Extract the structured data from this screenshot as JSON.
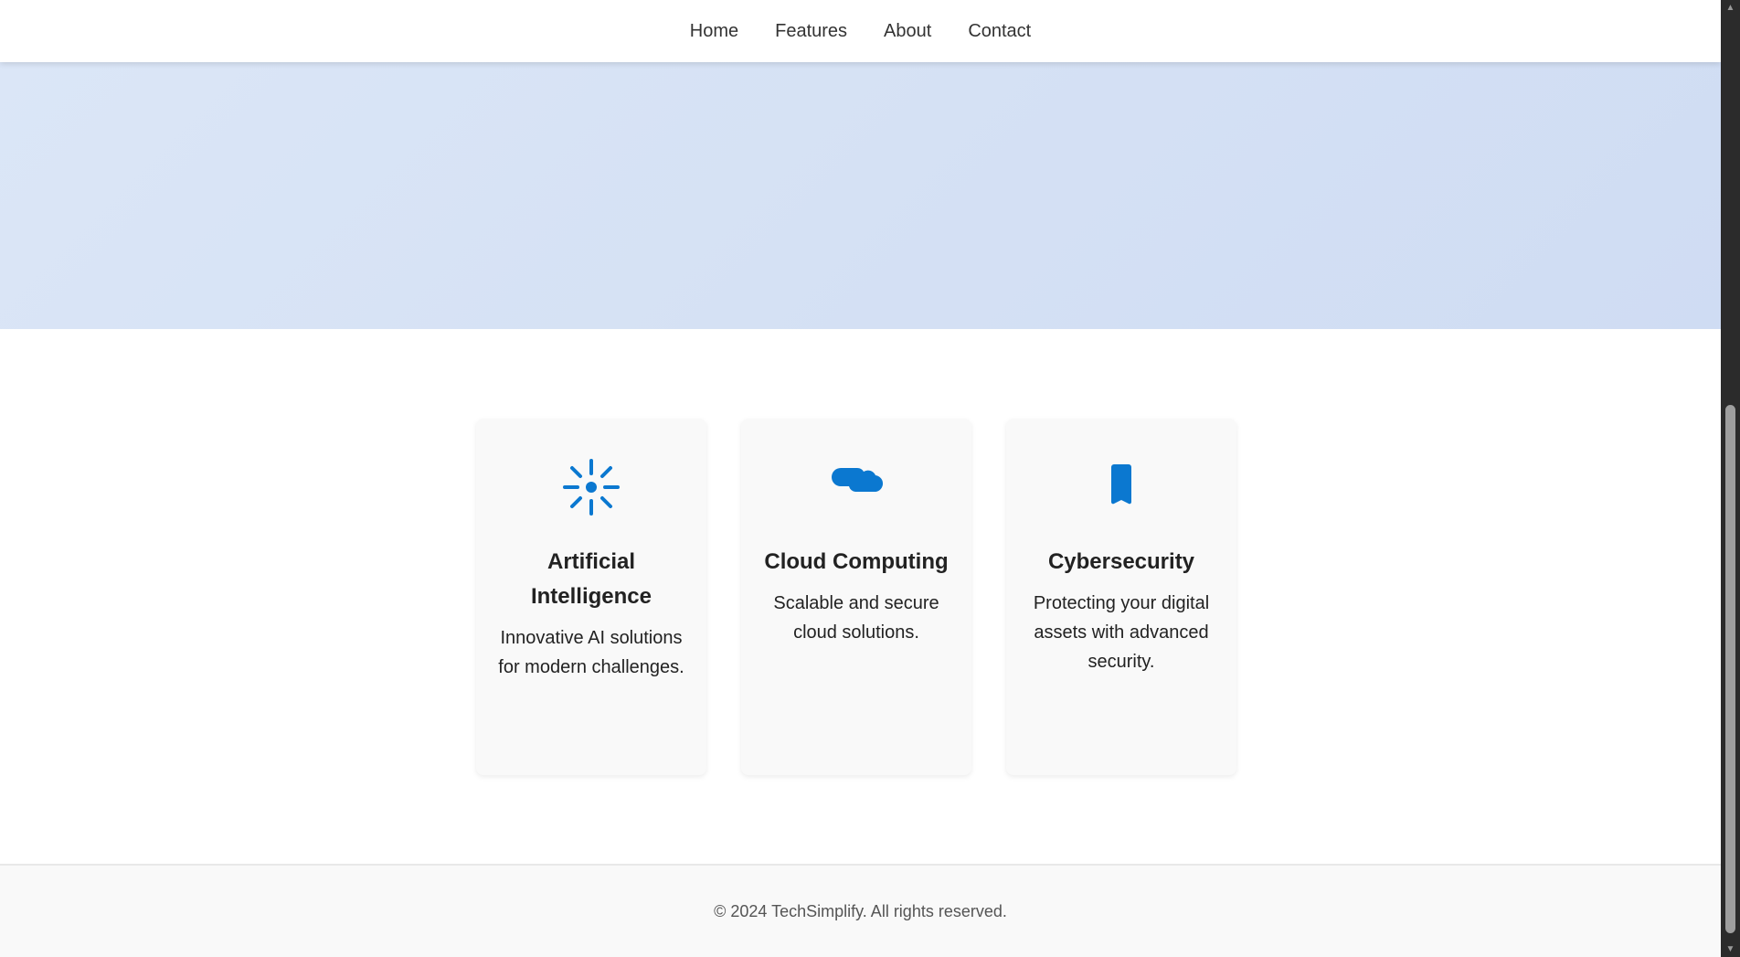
{
  "nav": {
    "items": [
      {
        "label": "Home"
      },
      {
        "label": "Features"
      },
      {
        "label": "About"
      },
      {
        "label": "Contact"
      }
    ]
  },
  "features": {
    "cards": [
      {
        "icon": "sun-burst-icon",
        "title": "Artificial Intelligence",
        "description": "Innovative AI solutions for modern challenges."
      },
      {
        "icon": "cloud-icon",
        "title": "Cloud Computing",
        "description": "Scalable and secure cloud solutions."
      },
      {
        "icon": "bookmark-icon",
        "title": "Cybersecurity",
        "description": "Protecting your digital assets with advanced security."
      }
    ]
  },
  "footer": {
    "text": "© 2024 TechSimplify. All rights reserved."
  },
  "colors": {
    "accent": "#0b78d0",
    "hero_bg": "#d6e2f5",
    "card_bg": "#f9f9f9",
    "text": "#222222"
  }
}
